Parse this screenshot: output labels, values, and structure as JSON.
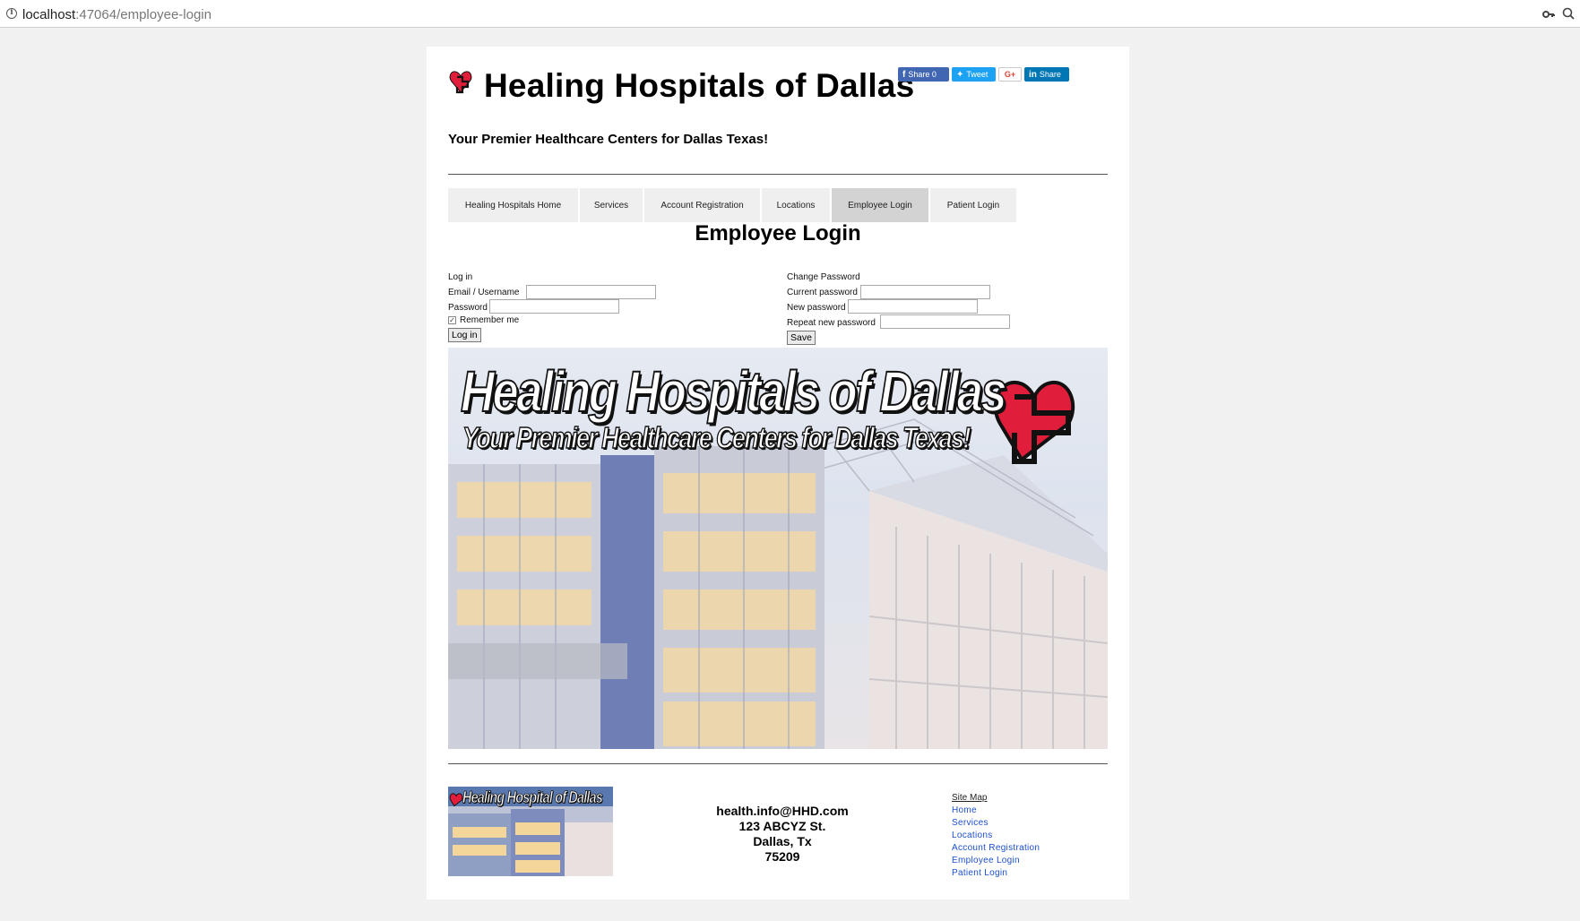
{
  "browser": {
    "url_host": "localhost",
    "url_rest": ":47064/employee-login"
  },
  "header": {
    "title": "Healing Hospitals of Dallas",
    "tagline": "Your Premier Healthcare Centers for Dallas Texas!",
    "brand_color": "#e01e3c"
  },
  "share": {
    "facebook": "Share 0",
    "twitter": "Tweet",
    "google": "G+",
    "linkedin": "Share"
  },
  "nav": {
    "items": [
      {
        "label": "Healing Hospitals Home"
      },
      {
        "label": "Services"
      },
      {
        "label": "Account Registration"
      },
      {
        "label": "Locations"
      },
      {
        "label": "Employee Login",
        "active": true
      },
      {
        "label": "Patient Login"
      }
    ]
  },
  "main": {
    "heading": "Employee Login",
    "login": {
      "section": "Log in",
      "email_label": "Email / Username",
      "email_value": "",
      "password_label": "Password",
      "password_value": "",
      "remember_label": "Remember me",
      "remember_checked": true,
      "submit_label": "Log in"
    },
    "change_password": {
      "section": "Change Password",
      "current_label": "Current password",
      "new_label": "New password",
      "repeat_label": "Repeat new password",
      "submit_label": "Save"
    },
    "hero": {
      "title": "Healing Hospitals of Dallas",
      "subtitle": "Your Premier Healthcare Centers for Dallas Texas!"
    }
  },
  "footer": {
    "logo_title": "Healing Hospital of Dallas",
    "email": "health.info@HHD.com",
    "street": "123 ABCYZ St.",
    "city": "Dallas, Tx",
    "zip": "75209",
    "sitemap": {
      "title": "Site Map",
      "links": [
        "Home",
        "Services",
        "Locations",
        "Account Registration",
        "Employee Login",
        "Patient Login"
      ]
    }
  }
}
